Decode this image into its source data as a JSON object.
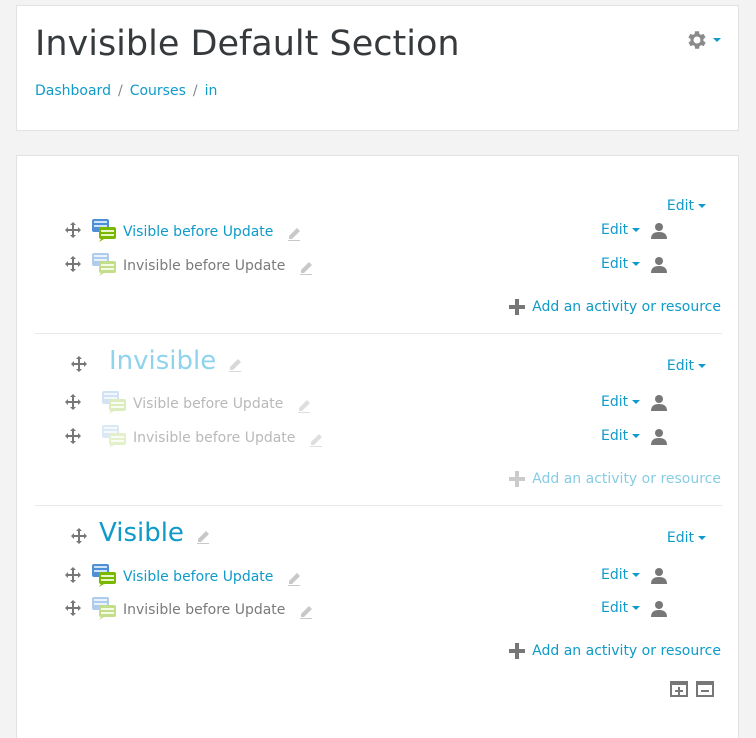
{
  "header": {
    "title": "Invisible Default Section",
    "breadcrumb": [
      {
        "label": "Dashboard"
      },
      {
        "label": "Courses"
      },
      {
        "label": "in"
      }
    ]
  },
  "sections": [
    {
      "title": "",
      "edit_label": "Edit",
      "activities": [
        {
          "name": "Visible before Update",
          "edit_label": "Edit",
          "visible": true
        },
        {
          "name": "Invisible before Update",
          "edit_label": "Edit",
          "visible": false
        }
      ],
      "add_label": "Add an activity or resource"
    },
    {
      "title": "Invisible",
      "edit_label": "Edit",
      "activities": [
        {
          "name": "Visible before Update",
          "edit_label": "Edit",
          "visible": true
        },
        {
          "name": "Invisible before Update",
          "edit_label": "Edit",
          "visible": false
        }
      ],
      "add_label": "Add an activity or resource"
    },
    {
      "title": "Visible",
      "edit_label": "Edit",
      "activities": [
        {
          "name": "Visible before Update",
          "edit_label": "Edit",
          "visible": true
        },
        {
          "name": "Invisible before Update",
          "edit_label": "Edit",
          "visible": false
        }
      ],
      "add_label": "Add an activity or resource"
    }
  ],
  "colors": {
    "link": "#0f9ac9",
    "page_bg": "#f3f3f3",
    "muted_text": "#7a7a7a"
  }
}
